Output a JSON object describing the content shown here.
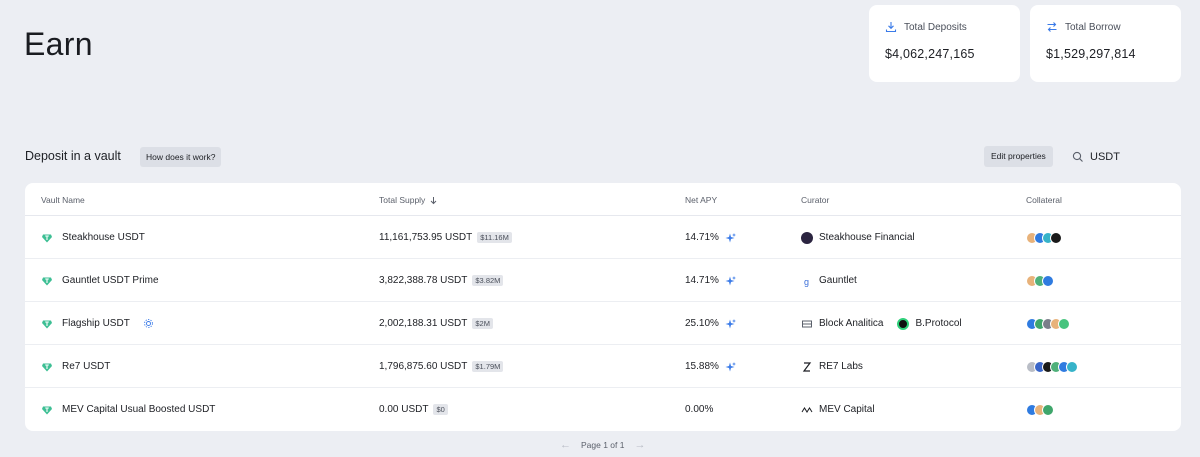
{
  "page": {
    "title": "Earn"
  },
  "stats": {
    "deposits": {
      "label": "Total Deposits",
      "value": "$4,062,247,165"
    },
    "borrow": {
      "label": "Total Borrow",
      "value": "$1,529,297,814"
    }
  },
  "section": {
    "title": "Deposit in a vault",
    "how_label": "How does it work?"
  },
  "toolbar": {
    "edit_label": "Edit properties",
    "search_value": "USDT"
  },
  "table": {
    "columns": {
      "name": "Vault Name",
      "supply": "Total Supply",
      "apy": "Net APY",
      "curator": "Curator",
      "collateral": "Collateral"
    },
    "rows": [
      {
        "name": "Steakhouse USDT",
        "supply": "11,161,753.95 USDT",
        "supply_badge": "$11.16M",
        "apy": "14.71%",
        "curator": "Steakhouse Financial",
        "curator2": "",
        "collateral": [
          "#e8b27a",
          "#2f7be0",
          "#36b3c9",
          "#1a1a1a"
        ]
      },
      {
        "name": "Gauntlet USDT Prime",
        "supply": "3,822,388.78 USDT",
        "supply_badge": "$3.82M",
        "apy": "14.71%",
        "curator": "Gauntlet",
        "curator2": "",
        "collateral": [
          "#e8b27a",
          "#4fb07a",
          "#2f7be0"
        ]
      },
      {
        "name": "Flagship USDT",
        "supply": "2,002,188.31 USDT",
        "supply_badge": "$2M",
        "apy": "25.10%",
        "curator": "Block Analitica",
        "curator2": "B.Protocol",
        "collateral": [
          "#2f7be0",
          "#3fa66b",
          "#7a7f8a",
          "#e8b27a",
          "#47c47e"
        ]
      },
      {
        "name": "Re7 USDT",
        "supply": "1,796,875.60 USDT",
        "supply_badge": "$1.79M",
        "apy": "15.88%",
        "curator": "RE7 Labs",
        "curator2": "",
        "collateral": [
          "#b9bdc6",
          "#3a66c9",
          "#1a1a1a",
          "#4fb07a",
          "#2f7be0",
          "#36b3c9"
        ]
      },
      {
        "name": "MEV Capital Usual Boosted USDT",
        "supply": "0.00 USDT",
        "supply_badge": "$0",
        "apy": "0.00%",
        "curator": "MEV Capital",
        "curator2": "",
        "collateral": [
          "#2f7be0",
          "#e8b27a",
          "#3fa66b"
        ]
      }
    ]
  },
  "pager": {
    "label": "Page 1 of 1"
  },
  "colors": {
    "background": "#eceef3",
    "accent": "#3b7be8",
    "tether": "#3dbf94"
  }
}
